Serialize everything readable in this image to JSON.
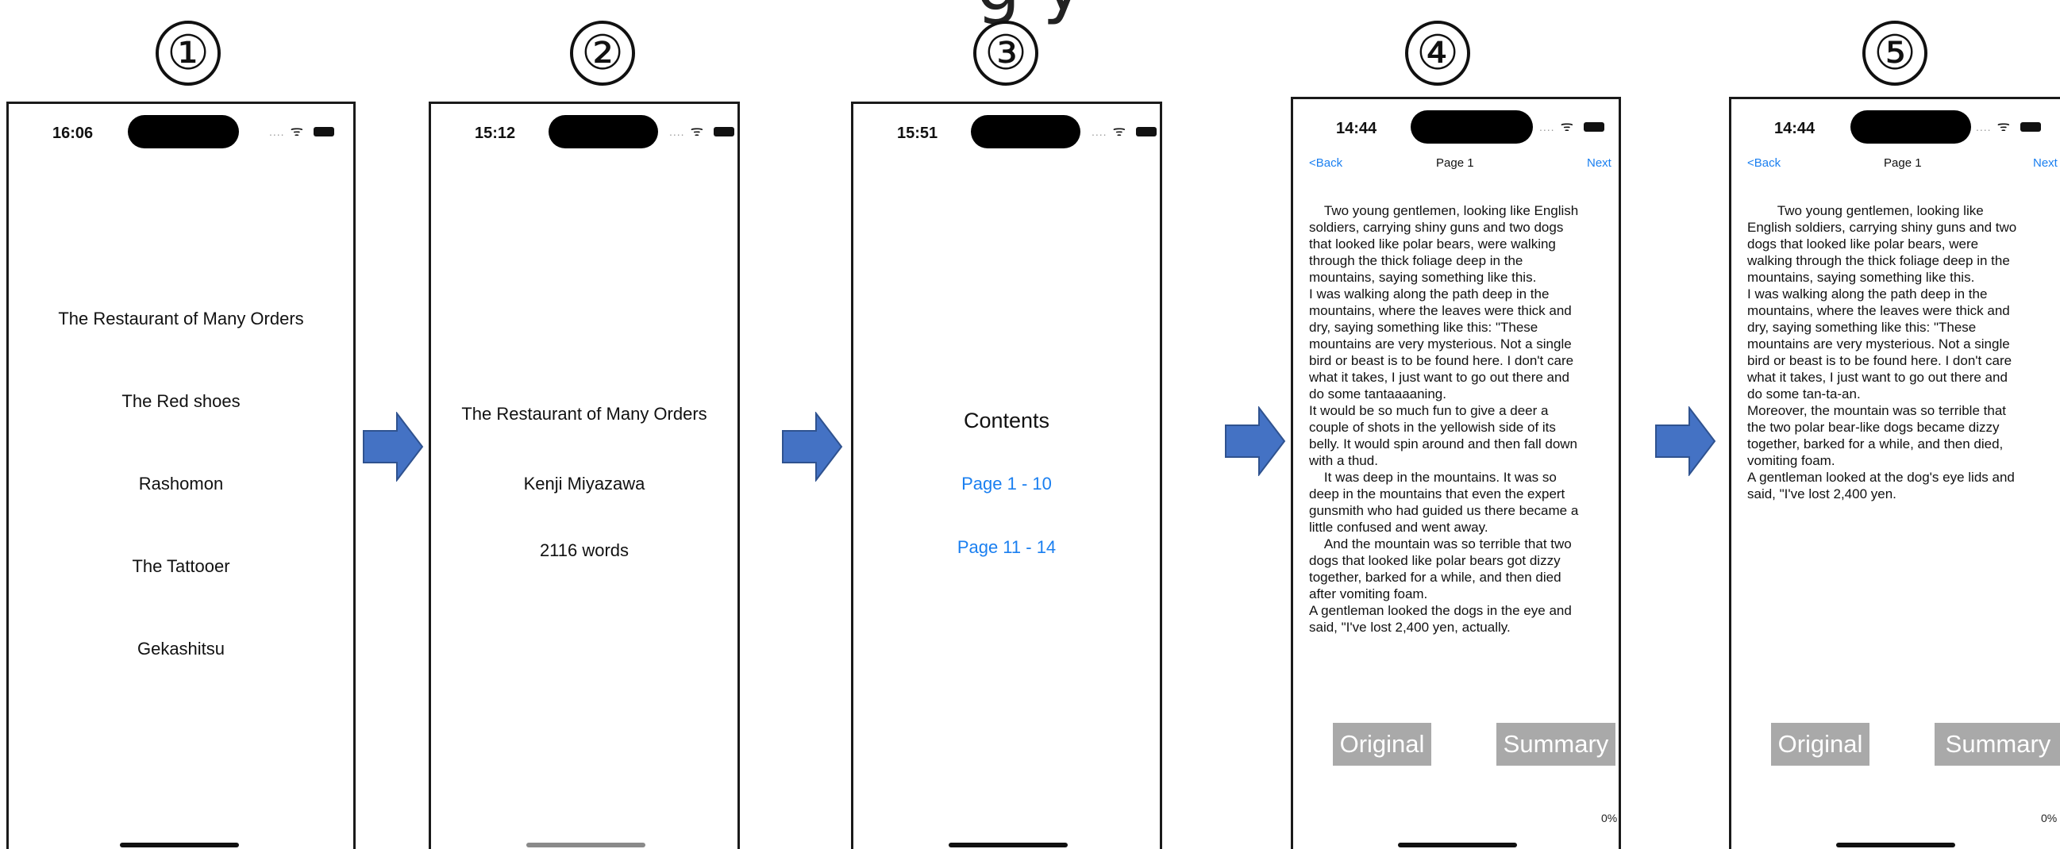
{
  "figure": {
    "title_fragment": "g                                    y"
  },
  "step_markers": [
    "①",
    "②",
    "③",
    "④",
    "⑤"
  ],
  "screen1": {
    "status_time": "16:06",
    "titles": [
      "The Restaurant of Many Orders",
      "The Red shoes",
      "Rashomon",
      "The Tattooer",
      "Gekashitsu"
    ]
  },
  "screen2": {
    "status_time": "15:12",
    "book_title": "The Restaurant of Many Orders",
    "author": "Kenji Miyazawa",
    "word_count": "2116 words"
  },
  "screen3": {
    "status_time": "15:51",
    "heading": "Contents",
    "page_links": [
      "Page 1 - 10",
      "Page 11 - 14"
    ]
  },
  "screen4": {
    "status_time": "14:44",
    "nav": {
      "back": "<Back",
      "title": "Page 1",
      "next": "Next"
    },
    "text": "    Two young gentlemen, looking like English\nsoldiers, carrying shiny guns and two dogs\nthat looked like polar bears, were walking\nthrough the thick foliage deep in the\nmountains, saying something like this.\nI was walking along the path deep in the\nmountains, where the leaves were thick and\ndry, saying something like this: \"These\nmountains are very mysterious. Not a single\nbird or beast is to be found here. I don't care\nwhat it takes, I just want to go out there and\ndo some tantaaaaning.\nIt would be so much fun to give a deer a\ncouple of shots in the yellowish side of its\nbelly. It would spin around and then fall down\nwith a thud.\n    It was deep in the mountains. It was so\ndeep in the mountains that even the expert\ngunsmith who had guided us there became a\nlittle confused and went away.\n    And the mountain was so terrible that two\ndogs that looked like polar bears got dizzy\ntogether, barked for a while, and then died\nafter vomiting foam.\nA gentleman looked the dogs in the eye and\nsaid, \"I've lost 2,400 yen, actually.",
    "original_label": "Original",
    "summary_label": "Summary",
    "progress": "0%"
  },
  "screen5": {
    "status_time": "14:44",
    "nav": {
      "back": "<Back",
      "title": "Page 1",
      "next": "Next"
    },
    "text": "        Two young gentlemen, looking like\nEnglish soldiers, carrying shiny guns and two\ndogs that looked like polar bears, were\nwalking through the thick foliage deep in the\nmountains, saying something like this.\nI was walking along the path deep in the\nmountains, where the leaves were thick and\ndry, saying something like this: \"These\nmountains are very mysterious. Not a single\nbird or beast is to be found here. I don't care\nwhat it takes, I just want to go out there and\ndo some tan-ta-an.\nMoreover, the mountain was so terrible that\nthe two polar bear-like dogs became dizzy\ntogether, barked for a while, and then died,\nvomiting foam.\nA gentleman looked at the dog's eye lids and\nsaid, \"I've lost 2,400 yen.",
    "original_label": "Original",
    "summary_label": "Summary",
    "progress": "0%"
  },
  "colors": {
    "link_blue": "#1a7ff0",
    "arrow_blue": "#4472c4",
    "button_gray": "#a9a9a9"
  }
}
